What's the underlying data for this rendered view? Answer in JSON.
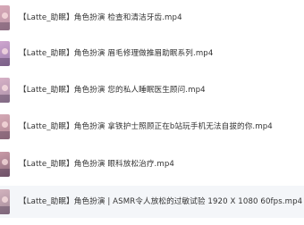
{
  "file_list": {
    "items": [
      {
        "name": "【Latte_助眠】角色扮演   检查和清洁牙齿.mp4",
        "thumb_colors": [
          "#d8a9b8",
          "#b893a4"
        ]
      },
      {
        "name": "【Latte_助眠】角色扮演   眉毛修理做推眉助眠系列.mp4",
        "thumb_colors": [
          "#cfa6cf",
          "#9d7fae"
        ]
      },
      {
        "name": "【Latte_助眠】角色扮演   您的私人睡眠医生顾问.mp4",
        "thumb_colors": [
          "#d7b1c6",
          "#a88fa8"
        ]
      },
      {
        "name": "【Latte_助眠】角色扮演   拿铁护士照顾正在b站玩手机无法自拔的你.mp4",
        "thumb_colors": [
          "#d4a9b5",
          "#b08693"
        ]
      },
      {
        "name": "【Latte_助眠】角色扮演   眼科放松治疗.mp4",
        "thumb_colors": [
          "#c89aa6",
          "#8c6a7d"
        ]
      },
      {
        "name": "【Latte_助眠】角色扮演 | ASMR令人放松的过敏试验  1920 X 1080 60fps.mp4",
        "thumb_colors": [
          "#d2b2bd",
          "#a38a99"
        ],
        "selected": true
      }
    ]
  }
}
